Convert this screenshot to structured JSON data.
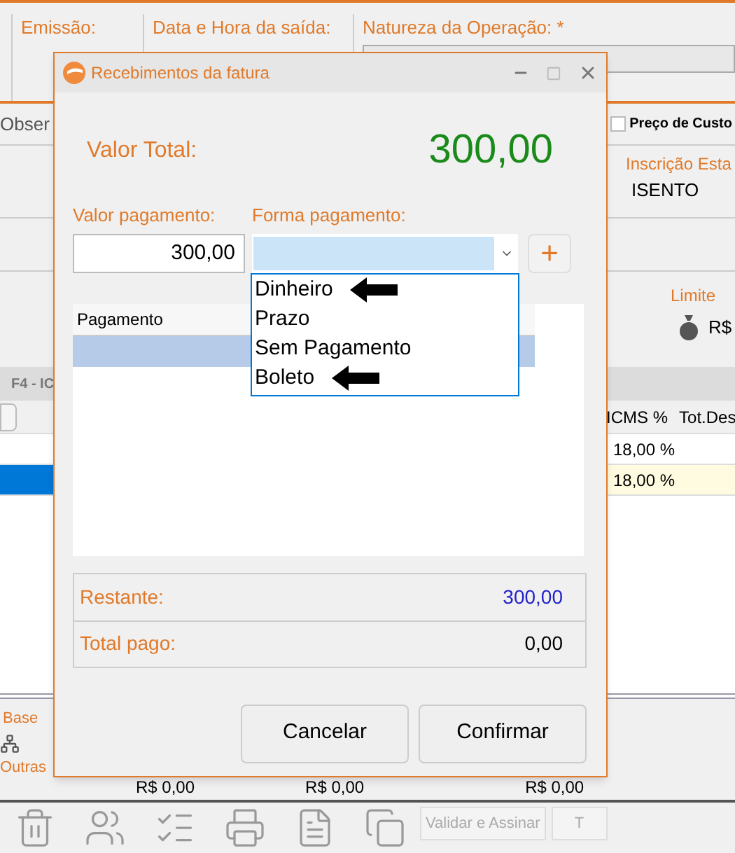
{
  "background": {
    "header_fields": [
      {
        "label": "Emissão:"
      },
      {
        "label": "Data e Hora da saída:"
      },
      {
        "label": "Natureza da Operação: *"
      }
    ],
    "tab_label": "Obser",
    "price_checkbox": {
      "label": "Preço de Custo",
      "checked": false
    },
    "registration": {
      "label": "Inscrição Esta",
      "value": "ISENTO"
    },
    "limit": {
      "label": "Limite",
      "value": "R$"
    },
    "section_label": "F4 - IC",
    "grid_columns": [
      "ICMS %",
      "Tot.Des"
    ],
    "grid_rows": [
      {
        "icms": "18,00 %",
        "selected": false
      },
      {
        "icms": "18,00 %",
        "selected": true
      }
    ],
    "totals": {
      "labels": [
        "Base",
        "Outras"
      ],
      "amounts": [
        "R$ 0,00",
        "R$ 0,00",
        "R$ 0,00"
      ]
    },
    "toolbar_buttons": [
      "Validar e Assinar",
      "T"
    ]
  },
  "dialog": {
    "title": "Recebimentos da fatura",
    "total_label": "Valor Total:",
    "total_value": "300,00",
    "payment_value_label": "Valor pagamento:",
    "payment_value": "300,00",
    "method_label": "Forma pagamento:",
    "add_button": "+",
    "options": [
      {
        "label": "Dinheiro",
        "selected": false,
        "marked": true
      },
      {
        "label": "Prazo",
        "selected": false,
        "marked": false
      },
      {
        "label": "Sem Pagamento",
        "selected": false,
        "marked": false
      },
      {
        "label": "Boleto",
        "selected": false,
        "marked": true
      }
    ],
    "table": {
      "columns": [
        "Pagamento"
      ],
      "rows": [
        {
          "selected": true
        }
      ]
    },
    "summary": [
      {
        "kind": "remaining",
        "label": "Restante:",
        "value": "300,00"
      },
      {
        "kind": "paid",
        "label": "Total pago:",
        "value": "0,00"
      }
    ],
    "buttons": [
      "Cancelar",
      "Confirmar"
    ]
  }
}
